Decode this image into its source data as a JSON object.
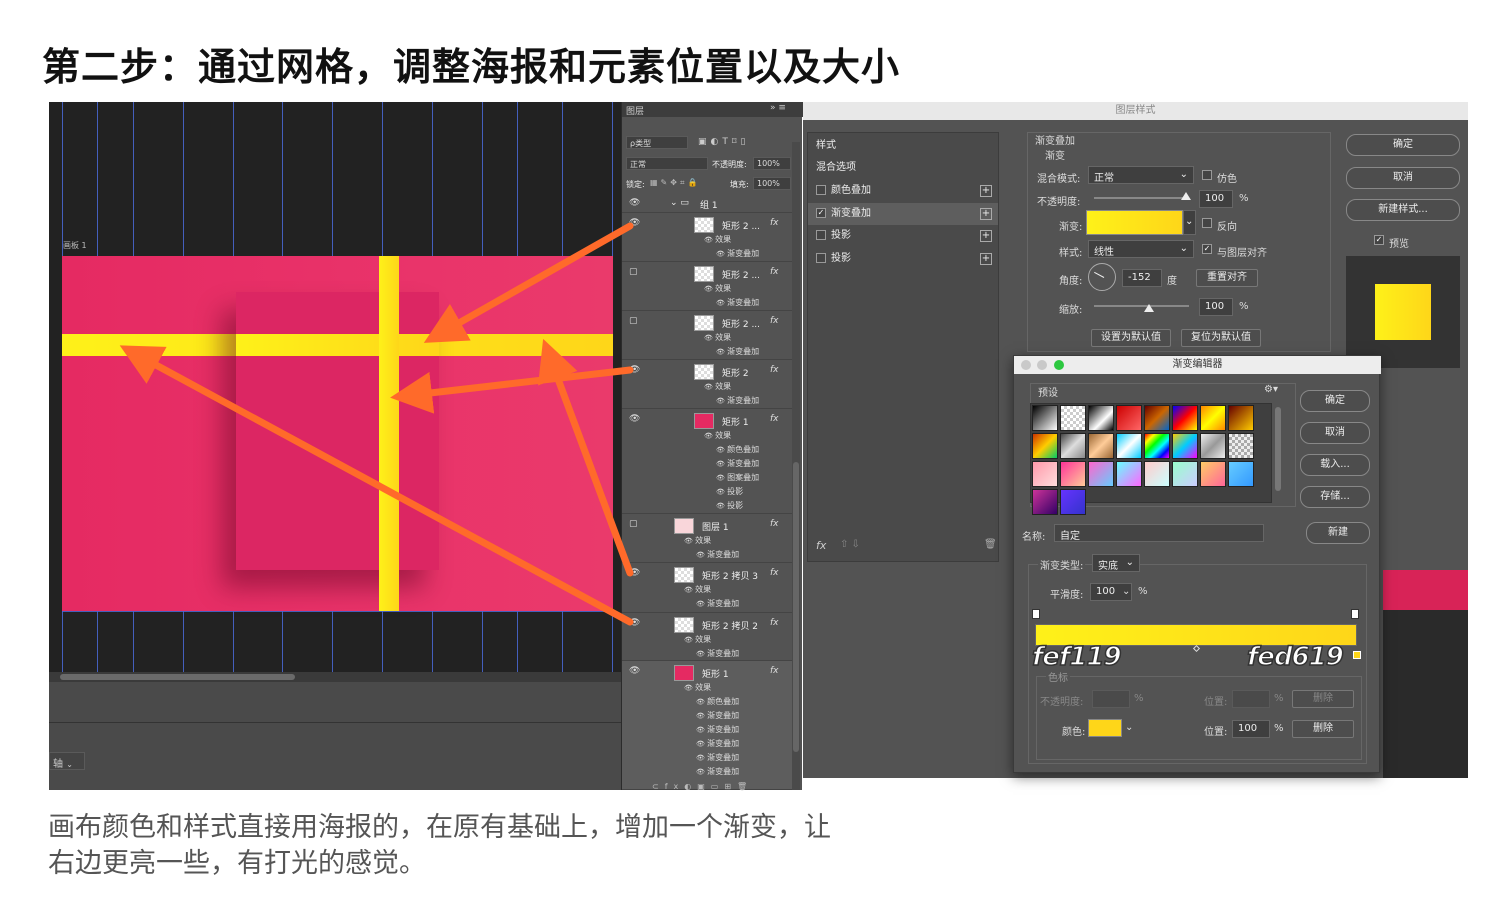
{
  "title": "第二步：通过网格，调整海报和元素位置以及大小",
  "caption": {
    "line1": "画布颜色和样式直接用海报的，在原有基础上，增加一个渐变，让",
    "line2": "右边更亮一些，有打光的感觉。"
  },
  "canvas": {
    "artboard_label": "画板 1",
    "axis_dropdown": "轴",
    "poster_color": "#e52a62",
    "band_color_left": "#fef119",
    "band_color_right": "#fed619"
  },
  "layers_panel": {
    "tab": "图层",
    "filter_dropdown": "ρ类型",
    "blend_mode": "正常",
    "opacity_label": "不透明度:",
    "opacity_value": "100%",
    "lock_label": "锁定:",
    "fill_label": "填充:",
    "fill_value": "100%",
    "group_name": "组 1",
    "layers": [
      {
        "name": "矩形 2 ...",
        "sub": [
          "效果",
          "渐变叠加"
        ]
      },
      {
        "name": "矩形 2 ...",
        "sub": [
          "效果",
          "渐变叠加"
        ]
      },
      {
        "name": "矩形 2 ...",
        "sub": [
          "效果",
          "渐变叠加"
        ]
      },
      {
        "name": "矩形 2",
        "sub": [
          "效果",
          "渐变叠加"
        ]
      },
      {
        "name": "矩形 1",
        "sub": [
          "效果",
          "颜色叠加",
          "渐变叠加",
          "图案叠加",
          "投影",
          "投影"
        ]
      },
      {
        "name": "图层 1",
        "sub": [
          "效果",
          "渐变叠加"
        ]
      },
      {
        "name": "矩形 2 拷贝 3",
        "sub": [
          "效果",
          "渐变叠加"
        ]
      },
      {
        "name": "矩形 2 拷贝 2",
        "sub": [
          "效果",
          "渐变叠加"
        ]
      },
      {
        "name": "矩形 1",
        "sub": [
          "效果",
          "颜色叠加",
          "渐变叠加",
          "渐变叠加",
          "渐变叠加",
          "渐变叠加",
          "渐变叠加"
        ]
      }
    ],
    "fx": "fx"
  },
  "layer_style": {
    "window_title": "图层样式",
    "styles_header": "样式",
    "blend_options": "混合选项",
    "items": [
      {
        "label": "颜色叠加",
        "checked": false
      },
      {
        "label": "渐变叠加",
        "checked": true
      },
      {
        "label": "投影",
        "checked": false
      },
      {
        "label": "投影",
        "checked": false
      }
    ],
    "section_title": "渐变叠加",
    "section_sub": "渐变",
    "blend_mode_label": "混合模式:",
    "blend_mode_value": "正常",
    "dither_label": "仿色",
    "opacity_label": "不透明度:",
    "opacity_value": "100",
    "percent": "%",
    "gradient_label": "渐变:",
    "reverse_label": "反向",
    "style_label": "样式:",
    "style_value": "线性",
    "align_label": "与图层对齐",
    "angle_label": "角度:",
    "angle_value": "-152",
    "degree": "度",
    "reset_align": "重置对齐",
    "scale_label": "缩放:",
    "scale_value": "100",
    "set_default": "设置为默认值",
    "reset_default": "复位为默认值",
    "ok": "确定",
    "cancel": "取消",
    "new_style": "新建样式...",
    "preview": "预览",
    "fx_bottom": "fx"
  },
  "gradient_editor": {
    "title": "渐变编辑器",
    "presets_label": "预设",
    "ok": "确定",
    "cancel": "取消",
    "load": "载入...",
    "save": "存储...",
    "name_label": "名称:",
    "name_value": "自定",
    "new": "新建",
    "type_label": "渐变类型:",
    "type_value": "实底",
    "smooth_label": "平滑度:",
    "smooth_value": "100",
    "percent": "%",
    "stop_left_hex": "fef119",
    "stop_right_hex": "fed619",
    "stops_label": "色标",
    "opacity_label": "不透明度:",
    "location_label": "位置:",
    "delete": "删除",
    "color_label": "颜色:",
    "location_value": "100",
    "stop_color": "#fed619"
  }
}
